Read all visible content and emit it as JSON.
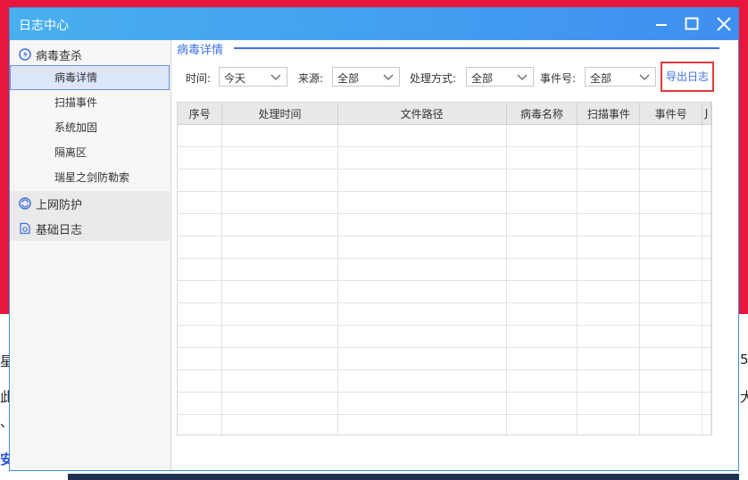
{
  "dialog": {
    "title": "日志中心",
    "controls": [
      "minimize-icon",
      "maximize-icon",
      "close-icon"
    ]
  },
  "sidebar": {
    "groups": [
      {
        "label": "病毒查杀",
        "icon": "virus-scan-icon",
        "items": [
          {
            "label": "病毒详情",
            "active": true
          },
          {
            "label": "扫描事件"
          },
          {
            "label": "系统加固"
          },
          {
            "label": "隔离区"
          },
          {
            "label": "瑞星之剑防勒索"
          }
        ]
      },
      {
        "label": "上网防护",
        "icon": "web-protection-icon"
      },
      {
        "label": "基础日志",
        "icon": "basic-log-icon"
      }
    ]
  },
  "main": {
    "section_title": "病毒详情",
    "filters": {
      "time": {
        "label": "时间:",
        "value": "今天"
      },
      "source": {
        "label": "来源:",
        "value": "全部"
      },
      "handling": {
        "label": "处理方式:",
        "value": "全部"
      },
      "event_no": {
        "label": "事件号:",
        "value": "全部"
      }
    },
    "export_button": "导出日志",
    "table": {
      "columns": [
        "序号",
        "处理时间",
        "文件路径",
        "病毒名称",
        "扫描事件",
        "事件号",
        "J"
      ],
      "rows": []
    }
  },
  "background": {
    "fragments": [
      "星",
      "5",
      "此",
      "大",
      "、",
      "安"
    ]
  },
  "colors": {
    "accent": "#3f70e0",
    "titlebar": "#49b0ef",
    "export_border": "#e53935",
    "background_red": "#e8163d"
  }
}
